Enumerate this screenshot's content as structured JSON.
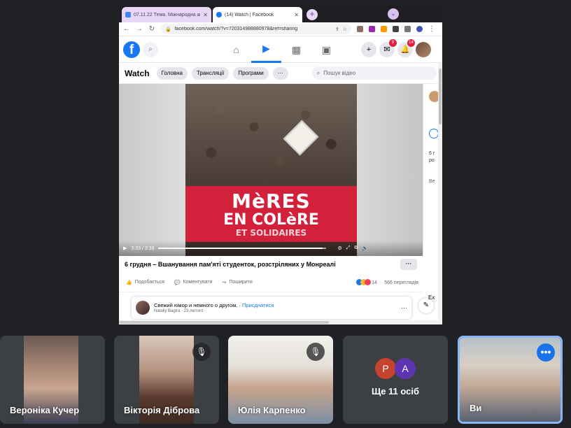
{
  "browser": {
    "tabs": [
      {
        "label": "07.11.22 Тема. Міжнародна акц",
        "active": false
      },
      {
        "label": "(14) Watch | Facebook",
        "active": true
      }
    ],
    "new_tab": "+",
    "url": "facebook.com/watch/?v=720314988880978&ref=sharing"
  },
  "facebook": {
    "logo": "f",
    "messenger_badge": "9",
    "notifications_badge": "14",
    "watch": {
      "title": "Watch",
      "pills": [
        "Головна",
        "Трансляції",
        "Програми",
        "···"
      ],
      "search_placeholder": "Пошук відео"
    },
    "video": {
      "banner_line1": "MèRES",
      "banner_line2": "EN COLèRE",
      "banner_line3": "ET SOLIDAIRES",
      "time": "3:33 / 3:38",
      "progress": 0.977,
      "title": "6 грудня – Вшанування пам'яті студенток, розстріляних у Монреалі",
      "more": "···"
    },
    "actions": {
      "like": "Подобається",
      "comment": "Коментувати",
      "share": "Поширити",
      "reactions_count": "14",
      "views": "566 переглядів"
    },
    "side": {
      "t1": "6 г",
      "t2": "ро",
      "t3": "Ве",
      "ex": "Ex"
    },
    "post": {
      "text": "Свежий юмор и немного о другом.",
      "join": "Присднатися",
      "author": "Nataliy Bagira · 23 лютого ·",
      "more": "···"
    }
  },
  "meet": {
    "participants": [
      {
        "name": "Вероніка Кучер",
        "muted": false
      },
      {
        "name": "Вікторія Діброва",
        "muted": true
      },
      {
        "name": "Юлія Карпенко",
        "muted": true
      }
    ],
    "more": {
      "label": "Ще 11 осіб",
      "letters": [
        {
          "char": "P",
          "color": "#c5432f"
        },
        {
          "char": "A",
          "color": "#5e35b1"
        }
      ]
    },
    "self": {
      "name": "Ви",
      "more": "•••"
    }
  }
}
